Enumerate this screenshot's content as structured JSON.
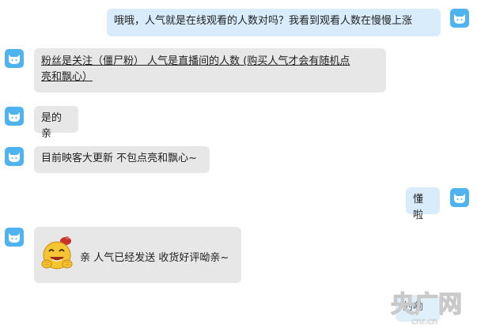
{
  "messages": [
    {
      "side": "right",
      "text": "哦哦，人气就是在线观看的人数对吗？我看到观看人数在慢慢上涨"
    },
    {
      "side": "left",
      "line1": "粉丝是关注（僵尸粉） 人气是直播间的人数 (购买人气才会有随机点",
      "line2": "亮和飘心）"
    },
    {
      "side": "left",
      "text": "是的亲"
    },
    {
      "side": "left",
      "text": "目前映客大更新 不包点亮和飘心~"
    },
    {
      "side": "right",
      "text": "懂啦"
    },
    {
      "side": "left",
      "text": "亲 人气已经发送 收货好评呦亲~",
      "sticker": "laughing-emoji"
    },
    {
      "side": "right",
      "text": "的嘞"
    }
  ],
  "watermark": {
    "main": "央广网",
    "sub": "cnr.cn"
  },
  "colors": {
    "avatar": "#4fb3f0",
    "bubble_left": "#e7e7e7",
    "bubble_right": "#d8ecfb"
  }
}
